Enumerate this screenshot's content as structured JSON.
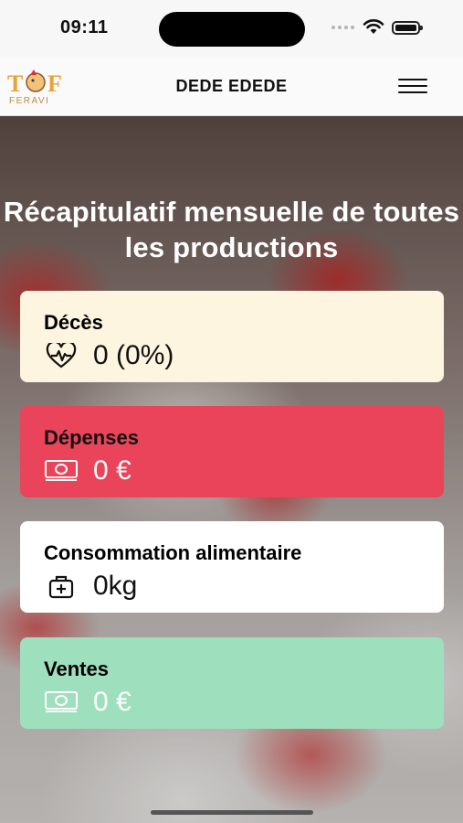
{
  "status_bar": {
    "time": "09:11"
  },
  "header": {
    "title": "DEDE EDEDE",
    "logo_text": "T3F",
    "logo_subtext": "FERAVI"
  },
  "main": {
    "heading": "Récapitulatif mensuelle de toutes les productions",
    "cards": [
      {
        "title": "Décès",
        "value": "0 (0%)",
        "icon": "heart-pulse-icon",
        "bg": "#fdf5df",
        "fg": "#111111"
      },
      {
        "title": "Dépenses",
        "value": "0 €",
        "icon": "money-icon",
        "bg": "#e9445a",
        "fg": "#111111",
        "value_color": "#ffffff"
      },
      {
        "title": "Consommation alimentaire",
        "value": "0kg",
        "icon": "feed-bag-icon",
        "bg": "#ffffff",
        "fg": "#111111"
      },
      {
        "title": "Ventes",
        "value": "0 €",
        "icon": "money-icon",
        "bg": "#9ee0bd",
        "fg": "#111111",
        "value_color": "#ffffff"
      }
    ]
  }
}
